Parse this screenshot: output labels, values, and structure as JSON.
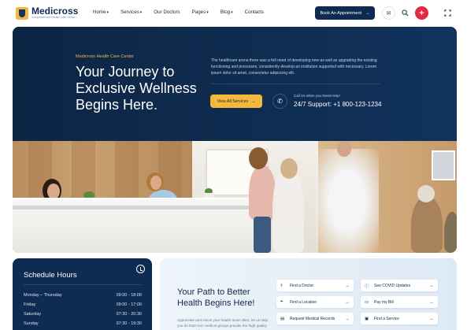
{
  "brand": {
    "name": "Medicross",
    "tagline": "Comprehensive Health Care Center"
  },
  "nav": {
    "items": [
      {
        "label": "Home",
        "caret": "▾"
      },
      {
        "label": "Services",
        "caret": "▾"
      },
      {
        "label": "Our Doctors",
        "caret": ""
      },
      {
        "label": "Pages",
        "caret": "▾"
      },
      {
        "label": "Blog",
        "caret": "▾"
      },
      {
        "label": "Contacts",
        "caret": ""
      }
    ],
    "appointment_button": "Book An Appointment",
    "arrow": "→"
  },
  "hero": {
    "eyebrow": "Medicross Health Care Center",
    "title": "Your Journey to Exclusive Wellness Begins Here.",
    "description": "The healthcare arena there was a felt need of developing new as well as upgrading the existing functioning and processes, consistently develop an institution supported with necessary. Lorem ipsum dolor sit amet, consectetur adipiscing elit.",
    "services_button": "View All Services",
    "help_label": "Call Us when you Need Help!",
    "support": "24/7 Support: +1 800-123-1234"
  },
  "schedule": {
    "title": "Schedule Hours",
    "rows": [
      {
        "day": "Monday – Thursday",
        "hours": "09:00 - 18:00"
      },
      {
        "day": "Friday",
        "hours": "09:00 - 17:00"
      },
      {
        "day": "Saturday",
        "hours": "07:30 - 20:30"
      },
      {
        "day": "Sunday",
        "hours": "07:30 - 19:30"
      }
    ]
  },
  "path": {
    "title": "Your Path to Better Health Begins Here!",
    "description": "Appreciate and check your health more often, let us help you do that! Our medical groups provide the high quality care you've all expect",
    "links": [
      {
        "label": "Find a Doctor",
        "icon": "doctor-icon",
        "glyph": "⚕"
      },
      {
        "label": "See COVID Updates",
        "icon": "info-icon",
        "glyph": "ⓘ"
      },
      {
        "label": "Find a Location",
        "icon": "location-pin-icon",
        "glyph": "⌖"
      },
      {
        "label": "Pay my Bill",
        "icon": "bill-icon",
        "glyph": "▭"
      },
      {
        "label": "Request Medical Records",
        "icon": "records-icon",
        "glyph": "▤"
      },
      {
        "label": "Find a Service",
        "icon": "service-icon",
        "glyph": "▣"
      }
    ],
    "arrow": "→"
  },
  "colors": {
    "navy": "#0e2b52",
    "accent_yellow": "#f5b83d",
    "accent_red": "#e8263f",
    "light_blue": "#e6eff8"
  }
}
